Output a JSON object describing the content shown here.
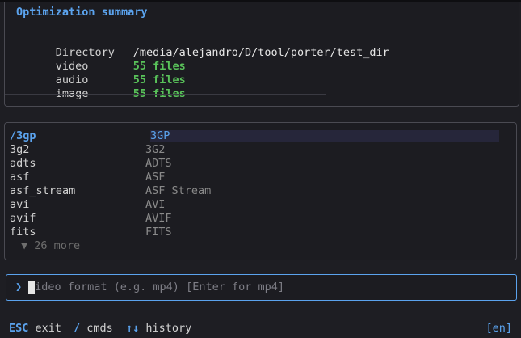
{
  "summary": {
    "title": "Optimization summary",
    "rows": [
      {
        "key": "Directory",
        "value": "/media/alejandro/D/tool/porter/test_dir"
      },
      {
        "key": "video",
        "value": "55 files"
      },
      {
        "key": "audio",
        "value": "55 files"
      },
      {
        "key": "image",
        "value": "55 files"
      }
    ]
  },
  "picker": {
    "options": [
      {
        "code": "/3gp",
        "desc": "3GP",
        "selected": true
      },
      {
        "code": "3g2",
        "desc": "3G2"
      },
      {
        "code": "adts",
        "desc": "ADTS"
      },
      {
        "code": "asf",
        "desc": "ASF"
      },
      {
        "code": "asf_stream",
        "desc": "ASF Stream"
      },
      {
        "code": "avi",
        "desc": "AVI"
      },
      {
        "code": "avif",
        "desc": "AVIF"
      },
      {
        "code": "fits",
        "desc": "FITS"
      }
    ],
    "more_label": "▼ 26 more"
  },
  "prompt": {
    "caret": "❯",
    "placeholder": "Video format (e.g. mp4) [Enter for mp4]",
    "value": ""
  },
  "statusbar": {
    "hints": [
      {
        "key": "ESC",
        "text": "exit"
      },
      {
        "key": "/",
        "text": "cmds"
      },
      {
        "key": "↑↓",
        "text": "history"
      }
    ],
    "language": "[en]"
  },
  "colors": {
    "accent": "#5ba3ee",
    "count": "#59c25a",
    "background": "#1e1e23"
  }
}
